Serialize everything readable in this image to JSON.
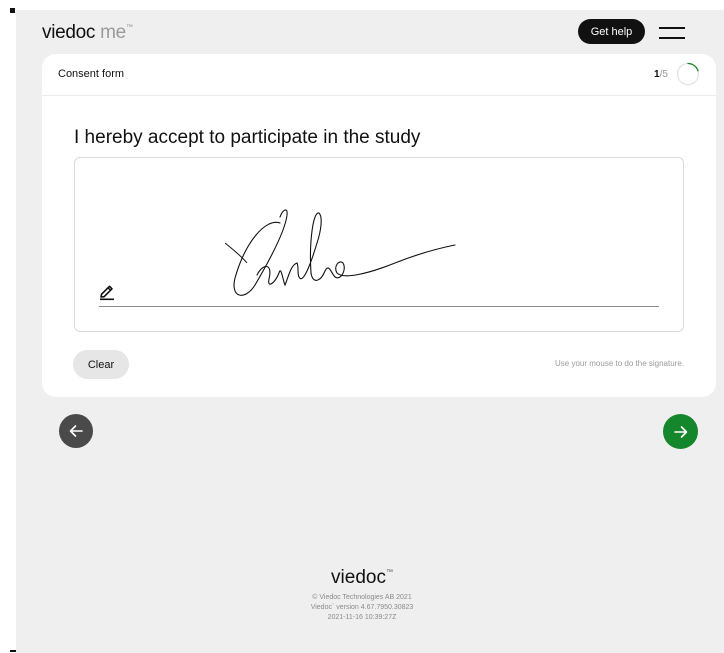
{
  "header": {
    "brand_main": "viedoc",
    "brand_sub": "me",
    "trademark": "™",
    "help_label": "Get help",
    "menu_icon": "hamburger-menu-icon"
  },
  "form": {
    "title": "Consent form",
    "progress_current": "1",
    "progress_total": "/5",
    "progress_fraction": 0.2,
    "question": "I hereby accept to participate in the study",
    "signature_text": "Carlos",
    "clear_label": "Clear",
    "hint": "Use your mouse to do the signature."
  },
  "nav": {
    "back_icon": "arrow-left-icon",
    "next_icon": "arrow-right-icon",
    "next_color": "#14862b",
    "back_color": "#4a4a4a"
  },
  "footer": {
    "logo": "viedoc",
    "trademark": "™",
    "copyright": "© Viedoc Technologies AB 2021",
    "version": "Viedoc` version 4.67.7950.30823",
    "timestamp": "2021-11-16 10:39:27Z"
  }
}
